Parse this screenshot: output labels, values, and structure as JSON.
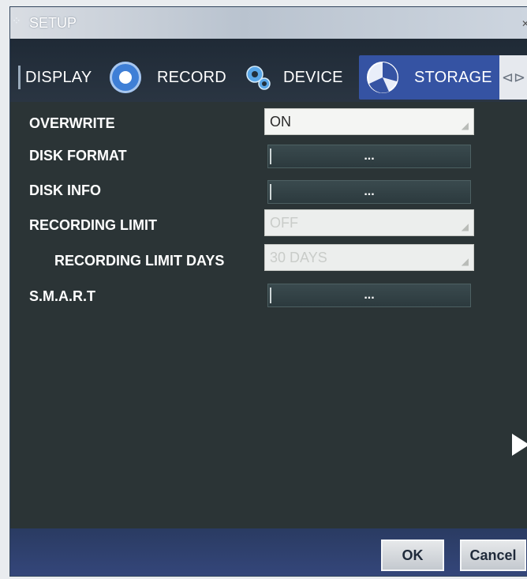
{
  "window": {
    "title": "SETUP"
  },
  "tabs": {
    "display": "DISPLAY",
    "record": "RECORD",
    "device": "DEVICE",
    "storage": "STORAGE",
    "arrows": "⊲⊳"
  },
  "settings": {
    "overwrite": {
      "label": "OVERWRITE",
      "value": "ON"
    },
    "disk_format": {
      "label": "DISK FORMAT",
      "button": "..."
    },
    "disk_info": {
      "label": "DISK INFO",
      "button": "..."
    },
    "recording_limit": {
      "label": "RECORDING LIMIT",
      "value": "OFF"
    },
    "recording_limit_days": {
      "label": "RECORDING LIMIT DAYS",
      "value": "30 DAYS"
    },
    "smart": {
      "label": "S.M.A.R.T",
      "button": "..."
    }
  },
  "footer": {
    "ok": "OK",
    "cancel": "Cancel"
  },
  "colors": {
    "active_tab": "#3553a3",
    "panel_bg": "#2b3436",
    "footer_bg": "#2f4170"
  }
}
